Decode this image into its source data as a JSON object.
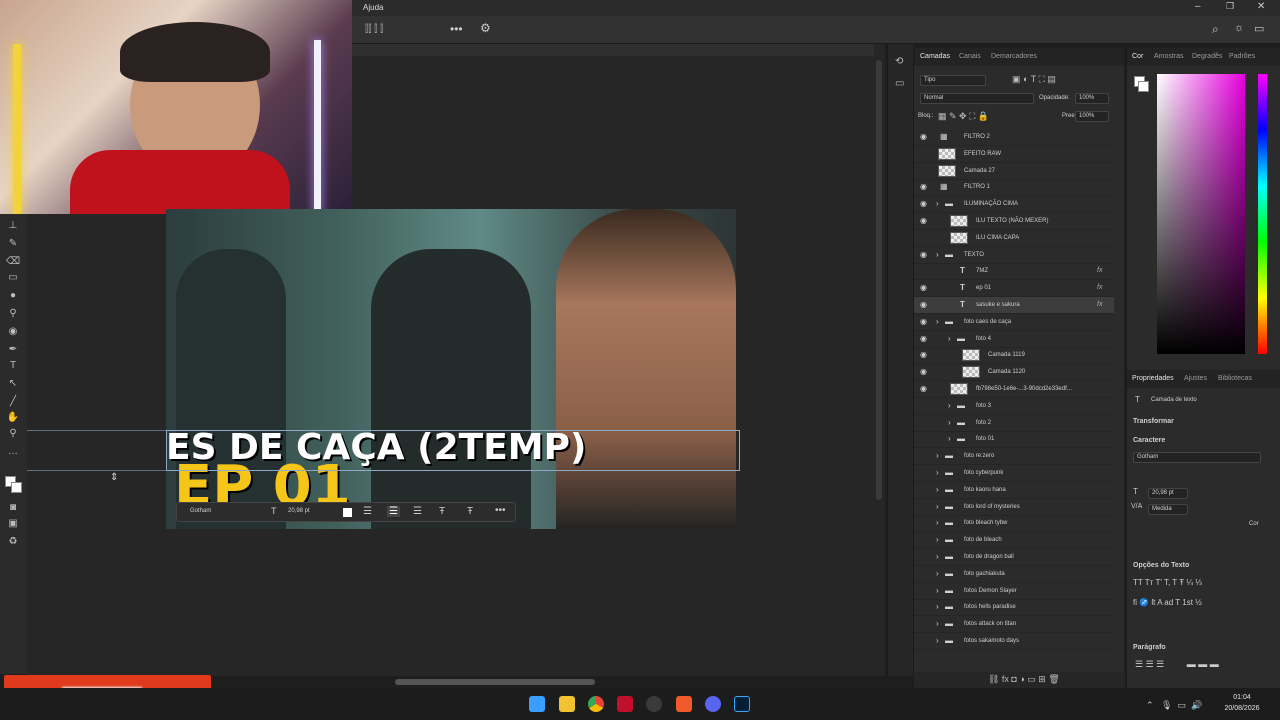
{
  "menu": {
    "item_ajuda": "Ajuda"
  },
  "layers_panel": {
    "tabs": [
      "Camadas",
      "Canais",
      "Demarcadores"
    ],
    "filter_label": "Tipo",
    "blend_mode": "Normal",
    "opacity_label": "Opacidade:",
    "opacity_value": "100%",
    "lock_label": "Bloq.:",
    "fill_label": "Preen.:",
    "fill_value": "100%",
    "layers": [
      {
        "name": "FILTRO 2",
        "kind": "adjustment",
        "indent": 0,
        "visible": true,
        "fx": false
      },
      {
        "name": "EFEITO RAW",
        "kind": "image",
        "indent": 0,
        "visible": false,
        "fx": false
      },
      {
        "name": "Camada 27",
        "kind": "image",
        "indent": 0,
        "visible": false,
        "fx": false
      },
      {
        "name": "FILTRO 1",
        "kind": "adjustment",
        "indent": 0,
        "visible": true,
        "fx": false
      },
      {
        "name": "ILUMINAÇÃO CIMA",
        "kind": "group",
        "indent": 0,
        "visible": true,
        "fx": false
      },
      {
        "name": "ILU TEXTO (NÃO MEXER)",
        "kind": "image",
        "indent": 1,
        "visible": true,
        "fx": false
      },
      {
        "name": "ILU CIMA CAPA",
        "kind": "image",
        "indent": 1,
        "visible": false,
        "fx": false
      },
      {
        "name": "TEXTO",
        "kind": "group",
        "indent": 0,
        "visible": true,
        "fx": false
      },
      {
        "name": "7MZ",
        "kind": "text",
        "indent": 1,
        "visible": false,
        "fx": true
      },
      {
        "name": "ep 01",
        "kind": "text",
        "indent": 1,
        "visible": true,
        "fx": true
      },
      {
        "name": "sasuke e sakura",
        "kind": "text",
        "indent": 1,
        "visible": true,
        "fx": true,
        "selected": true
      },
      {
        "name": "foto caes de caça",
        "kind": "group",
        "indent": 0,
        "visible": true,
        "fx": false
      },
      {
        "name": "foto 4",
        "kind": "group",
        "indent": 1,
        "visible": true,
        "fx": false
      },
      {
        "name": "Camada 1119",
        "kind": "image",
        "indent": 2,
        "visible": true,
        "fx": false
      },
      {
        "name": "Camada 1120",
        "kind": "image",
        "indent": 2,
        "visible": true,
        "fx": false
      },
      {
        "name": "fb798e50-1e6e-...3-90dcd2e33edf...",
        "kind": "image",
        "indent": 1,
        "visible": true,
        "fx": false
      },
      {
        "name": "foto 3",
        "kind": "group",
        "indent": 1,
        "visible": false,
        "fx": false
      },
      {
        "name": "foto 2",
        "kind": "group",
        "indent": 1,
        "visible": false,
        "fx": false
      },
      {
        "name": "foto 01",
        "kind": "group",
        "indent": 1,
        "visible": false,
        "fx": false
      },
      {
        "name": "foto re:zero",
        "kind": "group",
        "indent": 0,
        "visible": false,
        "fx": false
      },
      {
        "name": "foto cyberpunk",
        "kind": "group",
        "indent": 0,
        "visible": false,
        "fx": false
      },
      {
        "name": "foto kaoru hana",
        "kind": "group",
        "indent": 0,
        "visible": false,
        "fx": false
      },
      {
        "name": "foto lord of mysteries",
        "kind": "group",
        "indent": 0,
        "visible": false,
        "fx": false
      },
      {
        "name": "foto bleach tybw",
        "kind": "group",
        "indent": 0,
        "visible": false,
        "fx": false
      },
      {
        "name": "foto de bleach",
        "kind": "group",
        "indent": 0,
        "visible": false,
        "fx": false
      },
      {
        "name": "foto de dragon ball",
        "kind": "group",
        "indent": 0,
        "visible": false,
        "fx": false
      },
      {
        "name": "foto gachiakuta",
        "kind": "group",
        "indent": 0,
        "visible": false,
        "fx": false
      },
      {
        "name": "fotos Demon Slayer",
        "kind": "group",
        "indent": 0,
        "visible": false,
        "fx": false
      },
      {
        "name": "fotos hells paradise",
        "kind": "group",
        "indent": 0,
        "visible": false,
        "fx": false
      },
      {
        "name": "fotos  attack on titan",
        "kind": "group",
        "indent": 0,
        "visible": false,
        "fx": false
      },
      {
        "name": "fotos sakamoto days",
        "kind": "group",
        "indent": 0,
        "visible": false,
        "fx": false
      }
    ]
  },
  "color_panel": {
    "tabs": [
      "Cor",
      "Amostras",
      "Degradês",
      "Padrões"
    ]
  },
  "properties_panel": {
    "tabs": [
      "Propriedades",
      "Ajustes",
      "Bibliotecas"
    ],
    "layer_type": "Camada de texto",
    "section_transform": "Transformar",
    "section_character": "Caractere",
    "font": "Gotham",
    "size": "20,98 pt",
    "tracking": "Medida",
    "color_label": "Cor",
    "section_text_options": "Opções do Texto",
    "section_paragraph": "Parágrafo"
  },
  "canvas": {
    "headline": "ES DE CAÇA (2TEMP)",
    "episode": "EP 01"
  },
  "text_toolbar": {
    "font": "Gotham",
    "size": "20,98 pt"
  },
  "taskbar": {
    "time": "01:04",
    "date": "20/08/2026"
  },
  "colors": {
    "accent_yellow": "#f5c518",
    "stream_label": "#e03a1c",
    "selection": "#3d3d3d"
  }
}
